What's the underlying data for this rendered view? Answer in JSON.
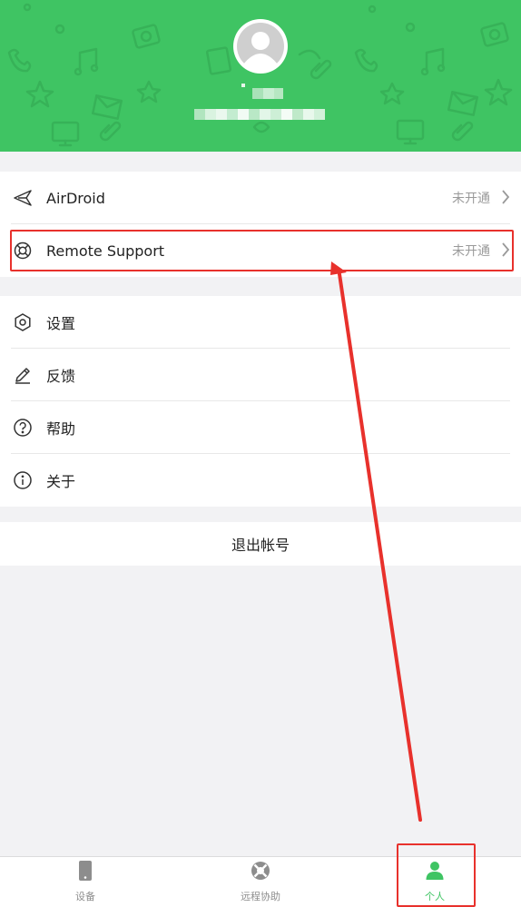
{
  "profile": {
    "avatar": "user-avatar-placeholder",
    "name_redacted": true,
    "email_redacted": true
  },
  "menu_group_1": [
    {
      "icon": "paper-plane-icon",
      "label": "AirDroid",
      "status": "未开通"
    },
    {
      "icon": "lifebuoy-icon",
      "label": "Remote Support",
      "status": "未开通"
    }
  ],
  "menu_group_2": [
    {
      "icon": "hexagon-settings-icon",
      "label": "设置"
    },
    {
      "icon": "pencil-icon",
      "label": "反馈"
    },
    {
      "icon": "question-circle-icon",
      "label": "帮助"
    },
    {
      "icon": "info-circle-icon",
      "label": "关于"
    }
  ],
  "logout_label": "退出帐号",
  "tabbar": {
    "tabs": [
      {
        "icon": "phone-icon",
        "label": "设备",
        "active": false
      },
      {
        "icon": "lifebuoy-icon",
        "label": "远程协助",
        "active": false
      },
      {
        "icon": "person-icon",
        "label": "个人",
        "active": true
      }
    ]
  },
  "colors": {
    "brand_green": "#3fc463",
    "annotation_red": "#e8312c"
  }
}
